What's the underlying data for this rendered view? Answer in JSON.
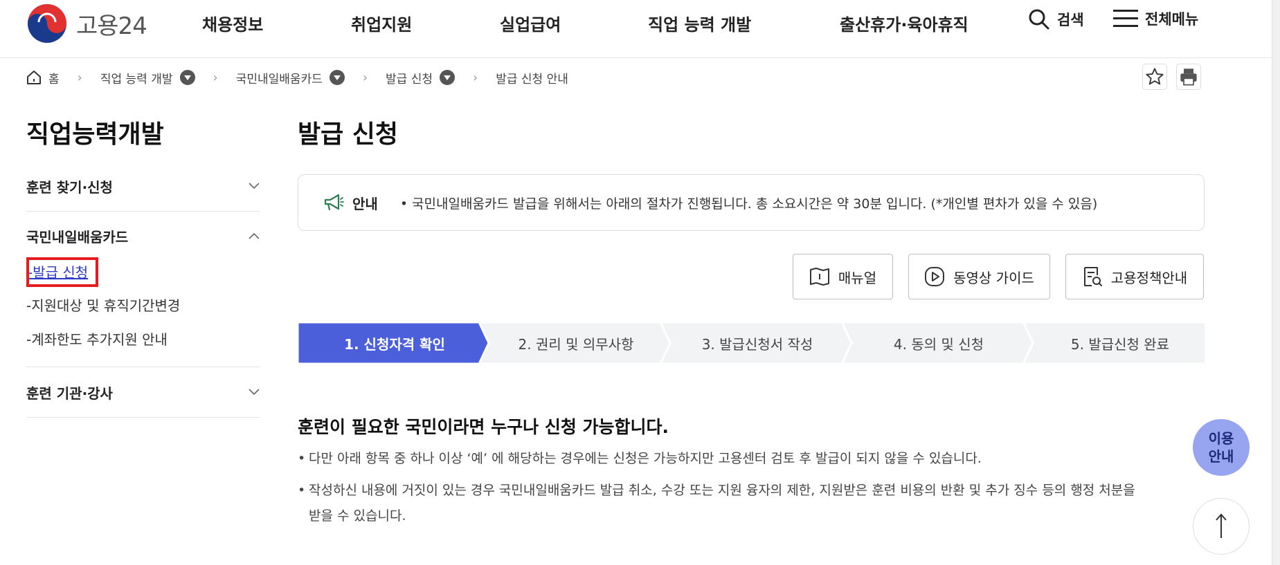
{
  "header": {
    "logo_text": "고용24",
    "nav": [
      "채용정보",
      "취업지원",
      "실업급여",
      "직업 능력 개발",
      "출산휴가·육아휴직"
    ],
    "search_label": "검색",
    "menu_label": "전체메뉴"
  },
  "breadcrumb": {
    "home": "홈",
    "items": [
      "직업 능력 개발",
      "국민내일배움카드",
      "발급 신청",
      "발급 신청 안내"
    ]
  },
  "sidebar": {
    "title": "직업능력개발",
    "groups": [
      {
        "label": "훈련 찾기·신청"
      },
      {
        "label": "국민내일배움카드"
      },
      {
        "label": "훈련 기관·강사"
      }
    ],
    "sub_items": [
      "-발급 신청",
      "-지원대상 및 휴직기간변경",
      "-계좌한도 추가지원 안내"
    ]
  },
  "main": {
    "title": "발급 신청",
    "notice": {
      "label": "안내",
      "text": "• 국민내일배움카드 발급을 위해서는 아래의 절차가 진행됩니다. 총 소요시간은 약 30분 입니다. (*개인별 편차가 있을 수 있음)"
    },
    "guide_buttons": [
      "매뉴얼",
      "동영상 가이드",
      "고용정책안내"
    ],
    "steps": [
      "1. 신청자격 확인",
      "2. 권리 및 의무사항",
      "3. 발급신청서 작성",
      "4. 동의 및 신청",
      "5. 발급신청 완료"
    ],
    "section_title": "훈련이 필요한 국민이라면 누구나 신청 가능합니다.",
    "bullets": [
      "다만 아래 항목 중 하나 이상 ‘예’ 에 해당하는 경우에는 신청은 가능하지만 고용센터 검토 후 발급이 되지 않을 수 있습니다.",
      "작성하신 내용에 거짓이 있는 경우 국민내일배움카드 발급 취소, 수강 또는 지원 융자의 제한, 지원받은 훈련 비용의 반환 및 추가 징수 등의 행정 처분을",
      "받을 수 있습니다."
    ]
  },
  "floating": {
    "info_line1": "이용",
    "info_line2": "안내"
  },
  "colors": {
    "step_active": "#4a5fd9",
    "step_inactive": "#f2f3f5",
    "highlight_box": "#e41e1e",
    "link_active": "#2c39c8",
    "float_info": "#97a4ef"
  }
}
